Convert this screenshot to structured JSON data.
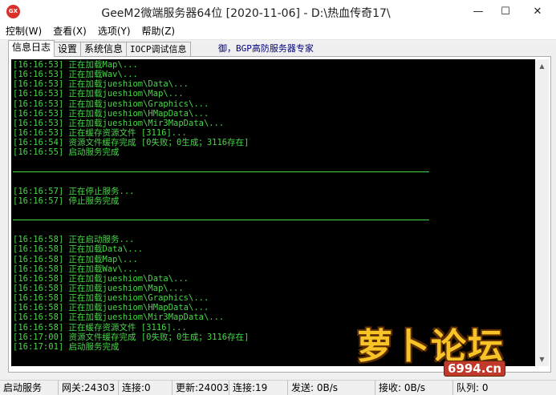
{
  "window": {
    "icon_text": "GX",
    "title": "GeeM2微端服务器64位 [2020-11-06] - D:\\热血传奇17\\"
  },
  "menu": [
    "控制(W)",
    "查看(X)",
    "选项(Y)",
    "帮助(Z)"
  ],
  "tabs": [
    "信息日志",
    "设置",
    "系统信息",
    "IOCP调试信息"
  ],
  "promo_text": "御，BGP高防服务器专家",
  "log_blocks": [
    [
      "[16:16:53] 正在加载Map\\...",
      "[16:16:53] 正在加载Wav\\...",
      "[16:16:53] 正在加载jueshiom\\Data\\...",
      "[16:16:53] 正在加载jueshiom\\Map\\...",
      "[16:16:53] 正在加载jueshiom\\Graphics\\...",
      "[16:16:53] 正在加载jueshiom\\HMapData\\...",
      "[16:16:53] 正在加载jueshiom\\Mir3MapData\\...",
      "[16:16:53] 正在缓存资源文件 [3116]...",
      "[16:16:54] 资源文件缓存完成 [0失败；0生成；3116存在]",
      "[16:16:55] 启动服务完成"
    ],
    [
      "[16:16:57] 正在停止服务...",
      "[16:16:57] 停止服务完成"
    ],
    [
      "[16:16:58] 正在启动服务...",
      "[16:16:58] 正在加载Data\\...",
      "[16:16:58] 正在加载Map\\...",
      "[16:16:58] 正在加载Wav\\...",
      "[16:16:58] 正在加载jueshiom\\Data\\...",
      "[16:16:58] 正在加载jueshiom\\Map\\...",
      "[16:16:58] 正在加载jueshiom\\Graphics\\...",
      "[16:16:58] 正在加载jueshiom\\HMapData\\...",
      "[16:16:58] 正在加载jueshiom\\Mir3MapData\\...",
      "[16:16:58] 正在缓存资源文件 [3116]...",
      "[16:17:00] 资源文件缓存完成 [0失败；0生成；3116存在]",
      "[16:17:01] 启动服务完成"
    ]
  ],
  "status": {
    "state": "启动服务",
    "gateway": "网关:24303",
    "conn1": "连接:0",
    "update": "更新:24003",
    "conn2": "连接:19",
    "send": "发送: 0B/s",
    "recv": "接收: 0B/s",
    "queue": "队列: 0"
  },
  "watermark": {
    "logo": "萝卜论坛",
    "url": "6994.cn"
  }
}
